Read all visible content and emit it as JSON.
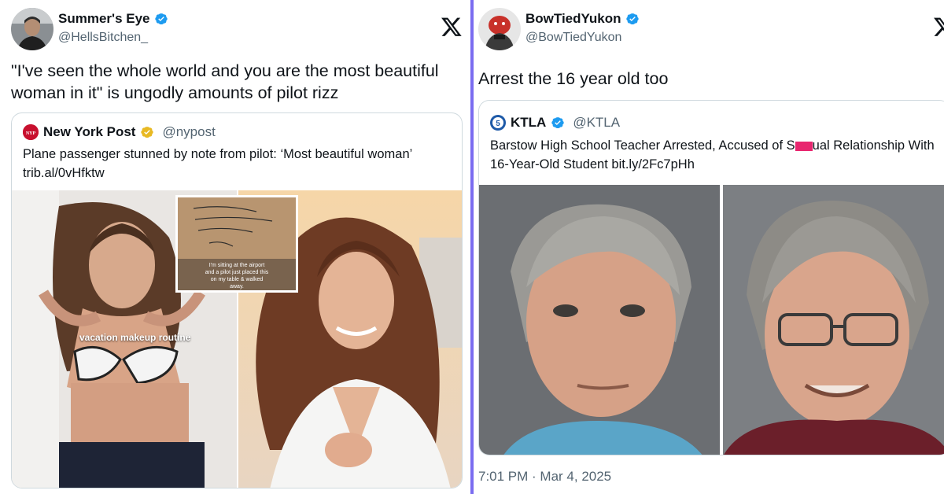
{
  "left_tweet": {
    "author": {
      "display_name": "Summer's Eye",
      "handle": "@HellsBitchen_"
    },
    "text": "\"I've seen the whole world and you are the most beautiful woman in it\" is ungodly amounts of pilot rizz",
    "quote": {
      "display_name": "New York Post",
      "handle": "@nypost",
      "text": "Plane passenger stunned by note from pilot: ‘Most beautiful woman’ trib.al/0vHfktw",
      "image_overlay": "vacation makeup routine",
      "note_caption": "I'm sitting at the airport and a pilot just placed this on my table & walked away."
    }
  },
  "right_tweet": {
    "author": {
      "display_name": "BowTiedYukon",
      "handle": "@BowTiedYukon"
    },
    "text": "Arrest the 16 year old too",
    "quote": {
      "display_name": "KTLA",
      "handle": "@KTLA",
      "text_before": "Barstow High School Teacher Arrested, Accused of S",
      "text_after": "ual Relationship With 16-Year-Old Student bit.ly/2Fc7pHh"
    },
    "timestamp": "7:01 PM · Mar 4, 2025"
  },
  "colors": {
    "verified": "#1d9bf0",
    "gold_badge": "#e8b923",
    "divider": "#7a6cf0",
    "redaction": "#e8266f",
    "nypost_red": "#c8102e",
    "ktla_blue": "#1e5aa8"
  }
}
